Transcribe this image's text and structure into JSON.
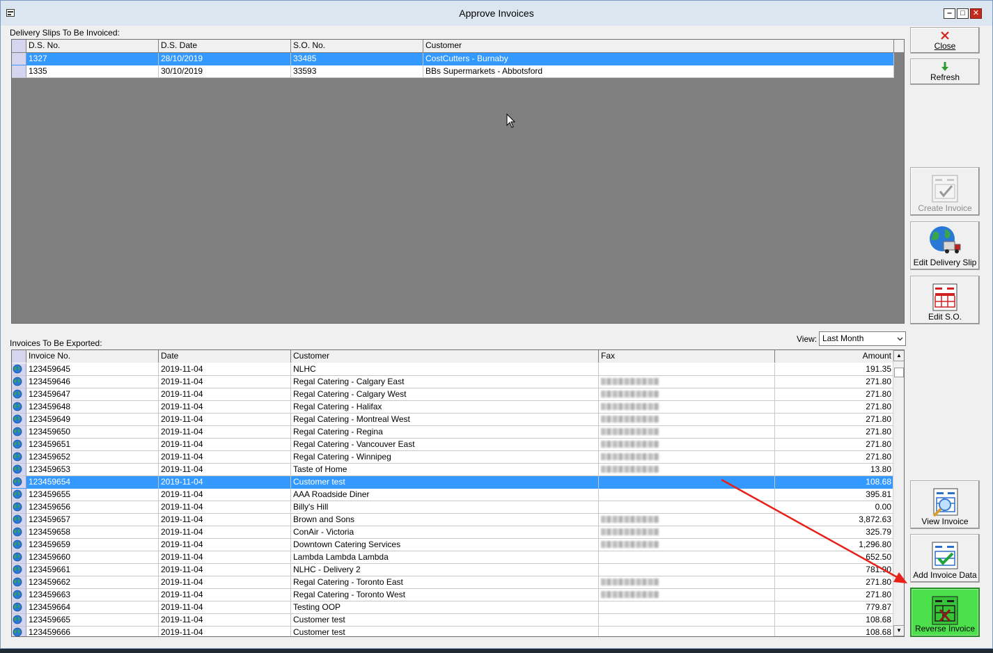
{
  "window": {
    "title": "Approve Invoices",
    "controls": {
      "minimize": "‒",
      "maximize": "□",
      "close": "✕"
    }
  },
  "delivery_slips": {
    "label": "Delivery Slips To Be Invoiced:",
    "columns": [
      "D.S. No.",
      "D.S. Date",
      "S.O. No.",
      "Customer"
    ],
    "rows": [
      {
        "ds_no": "1327",
        "ds_date": "28/10/2019",
        "so_no": "33485",
        "customer": "CostCutters - Burnaby",
        "selected": true
      },
      {
        "ds_no": "1335",
        "ds_date": "30/10/2019",
        "so_no": "33593",
        "customer": "BBs Supermarkets - Abbotsford",
        "selected": false
      }
    ]
  },
  "invoices": {
    "label": "Invoices To Be Exported:",
    "view_label": "View:",
    "view_value": "Last Month",
    "columns": [
      "Invoice No.",
      "Date",
      "Customer",
      "Fax",
      "Amount"
    ],
    "rows": [
      {
        "no": "123459645",
        "date": "2019-11-04",
        "customer": "NLHC",
        "fax": false,
        "amount": "191.35"
      },
      {
        "no": "123459646",
        "date": "2019-11-04",
        "customer": "Regal Catering - Calgary East",
        "fax": true,
        "amount": "271.80"
      },
      {
        "no": "123459647",
        "date": "2019-11-04",
        "customer": "Regal Catering - Calgary West",
        "fax": true,
        "amount": "271.80"
      },
      {
        "no": "123459648",
        "date": "2019-11-04",
        "customer": "Regal Catering - Halifax",
        "fax": true,
        "amount": "271.80"
      },
      {
        "no": "123459649",
        "date": "2019-11-04",
        "customer": "Regal Catering - Montreal West",
        "fax": true,
        "amount": "271.80"
      },
      {
        "no": "123459650",
        "date": "2019-11-04",
        "customer": "Regal Catering - Regina",
        "fax": true,
        "amount": "271.80"
      },
      {
        "no": "123459651",
        "date": "2019-11-04",
        "customer": "Regal Catering - Vancouver East",
        "fax": true,
        "amount": "271.80"
      },
      {
        "no": "123459652",
        "date": "2019-11-04",
        "customer": "Regal Catering - Winnipeg",
        "fax": true,
        "amount": "271.80"
      },
      {
        "no": "123459653",
        "date": "2019-11-04",
        "customer": "Taste of Home",
        "fax": true,
        "amount": "13.80"
      },
      {
        "no": "123459654",
        "date": "2019-11-04",
        "customer": "Customer test",
        "fax": false,
        "amount": "108.68",
        "selected": true
      },
      {
        "no": "123459655",
        "date": "2019-11-04",
        "customer": "AAA Roadside Diner",
        "fax": false,
        "amount": "395.81"
      },
      {
        "no": "123459656",
        "date": "2019-11-04",
        "customer": "Billy's Hill",
        "fax": false,
        "amount": "0.00"
      },
      {
        "no": "123459657",
        "date": "2019-11-04",
        "customer": "Brown and Sons",
        "fax": true,
        "amount": "3,872.63"
      },
      {
        "no": "123459658",
        "date": "2019-11-04",
        "customer": "ConAir - Victoria",
        "fax": true,
        "amount": "325.79"
      },
      {
        "no": "123459659",
        "date": "2019-11-04",
        "customer": "Downtown Catering Services",
        "fax": true,
        "amount": "1,296.80"
      },
      {
        "no": "123459660",
        "date": "2019-11-04",
        "customer": "Lambda Lambda Lambda",
        "fax": false,
        "amount": "652.50"
      },
      {
        "no": "123459661",
        "date": "2019-11-04",
        "customer": "NLHC - Delivery 2",
        "fax": false,
        "amount": "781.90"
      },
      {
        "no": "123459662",
        "date": "2019-11-04",
        "customer": "Regal Catering - Toronto East",
        "fax": true,
        "amount": "271.80"
      },
      {
        "no": "123459663",
        "date": "2019-11-04",
        "customer": "Regal Catering - Toronto West",
        "fax": true,
        "amount": "271.80"
      },
      {
        "no": "123459664",
        "date": "2019-11-04",
        "customer": "Testing OOP",
        "fax": false,
        "amount": "779.87"
      },
      {
        "no": "123459665",
        "date": "2019-11-04",
        "customer": "Customer test",
        "fax": false,
        "amount": "108.68"
      },
      {
        "no": "123459666",
        "date": "2019-11-04",
        "customer": "Customer test",
        "fax": false,
        "amount": "108.68"
      }
    ]
  },
  "buttons": {
    "close": "Close",
    "refresh": "Refresh",
    "create_invoice": "Create Invoice",
    "edit_delivery_slip": "Edit Delivery Slip",
    "edit_so": "Edit S.O.",
    "view_invoice": "View Invoice",
    "add_invoice_data": "Add Invoice Data",
    "reverse_invoice": "Reverse Invoice"
  },
  "colors": {
    "selection": "#3399ff",
    "highlight_button": "#4de04d",
    "annotation_arrow": "#e8201a"
  }
}
